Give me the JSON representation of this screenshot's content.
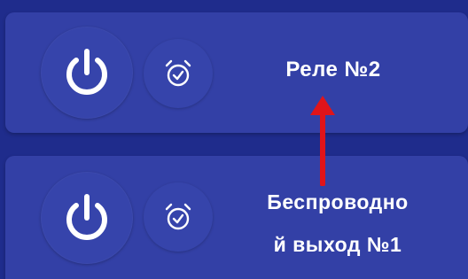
{
  "relays": [
    {
      "name": "Реле №2",
      "power_icon": "power-icon",
      "timer_icon": "alarm-clock-check-icon"
    },
    {
      "name_line_1": "Беспроводно",
      "name_line_2": "й выход №1",
      "power_icon": "power-icon",
      "timer_icon": "alarm-clock-check-icon"
    }
  ],
  "colors": {
    "background": "#1f2c8c",
    "card": "#3340a6",
    "button": "#3644ab",
    "text": "#ffffff",
    "arrow": "#e0141a"
  }
}
